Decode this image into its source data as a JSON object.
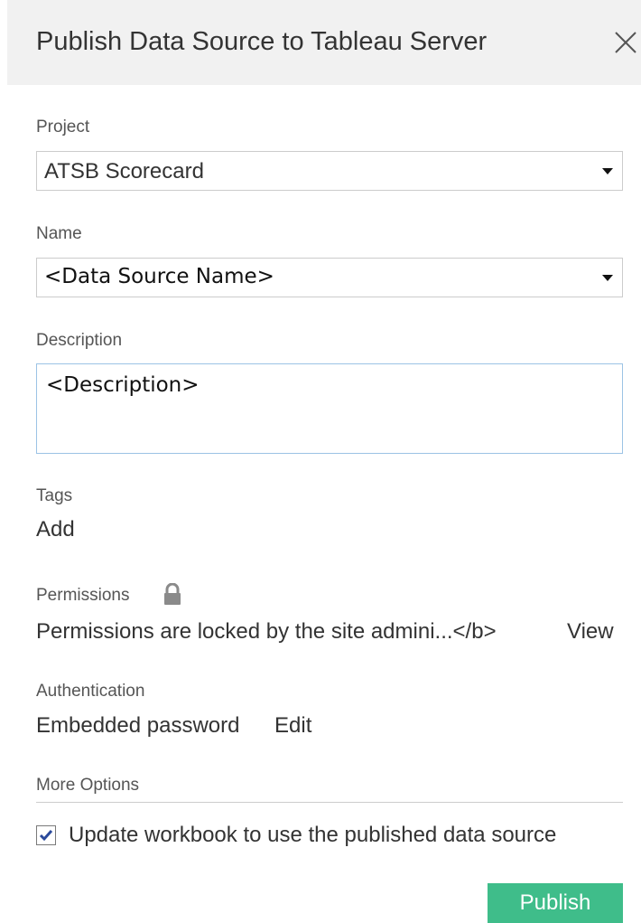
{
  "dialog": {
    "title": "Publish Data Source to Tableau Server"
  },
  "project": {
    "label": "Project",
    "value": "ATSB Scorecard"
  },
  "name": {
    "label": "Name",
    "value": "<Data Source Name>"
  },
  "description": {
    "label": "Description",
    "value": "<Description>"
  },
  "tags": {
    "label": "Tags",
    "add_link": "Add"
  },
  "permissions": {
    "label": "Permissions",
    "icon": "lock-icon",
    "text": "Permissions are locked by the site admini...</b>",
    "view_link": "View"
  },
  "authentication": {
    "label": "Authentication",
    "text": "Embedded password",
    "edit_link": "Edit"
  },
  "more_options": {
    "label": "More Options",
    "update_workbook": {
      "checked": true,
      "label": "Update workbook to use the published data source"
    }
  },
  "footer": {
    "publish_label": "Publish"
  },
  "colors": {
    "link": "#2d7fb8",
    "publish_button": "#3fbd8a",
    "header_bg": "#f1f1f1",
    "checkbox_check": "#2b4a9b"
  }
}
